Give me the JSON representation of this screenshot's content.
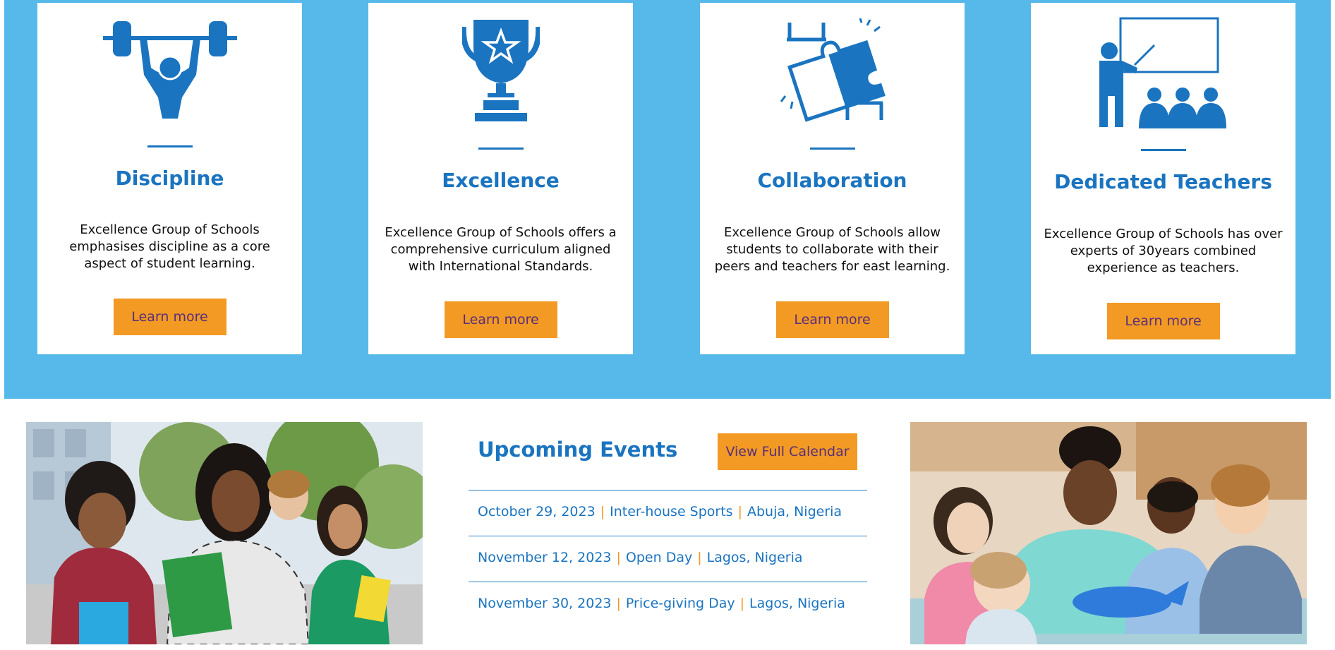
{
  "features": [
    {
      "icon": "weightlifter-icon",
      "title": "Discipline",
      "text": "Excellence Group of Schools emphasises discipline as a core aspect of student learning.",
      "button": "Learn more"
    },
    {
      "icon": "trophy-icon",
      "title": "Excellence",
      "text": "Excellence Group of Schools offers a comprehensive curriculum aligned with International Standards.",
      "button": "Learn more"
    },
    {
      "icon": "puzzle-collaboration-icon",
      "title": "Collaboration",
      "text": "Excellence Group of Schools allow students to collaborate with their peers and teachers for east learning.",
      "button": "Learn more"
    },
    {
      "icon": "teacher-class-icon",
      "title": "Dedicated Teachers",
      "text": "Excellence Group of Schools has over experts of 30years combined experience as teachers.",
      "button": "Learn more"
    }
  ],
  "events": {
    "title": "Upcoming Events",
    "calendar_button": "View Full Calendar",
    "items": [
      {
        "date": "October 29, 2023",
        "name": "Inter-house Sports",
        "location": "Abuja, Nigeria"
      },
      {
        "date": "November 12, 2023",
        "name": "Open Day",
        "location": "Lagos, Nigeria"
      },
      {
        "date": "November 30, 2023",
        "name": "Price-giving Day",
        "location": "Lagos, Nigeria"
      }
    ],
    "separator": "|"
  },
  "colors": {
    "band": "#56b9ea",
    "accent_blue": "#1a74c0",
    "button_orange": "#f29a24",
    "button_text": "#5a2f7a"
  }
}
